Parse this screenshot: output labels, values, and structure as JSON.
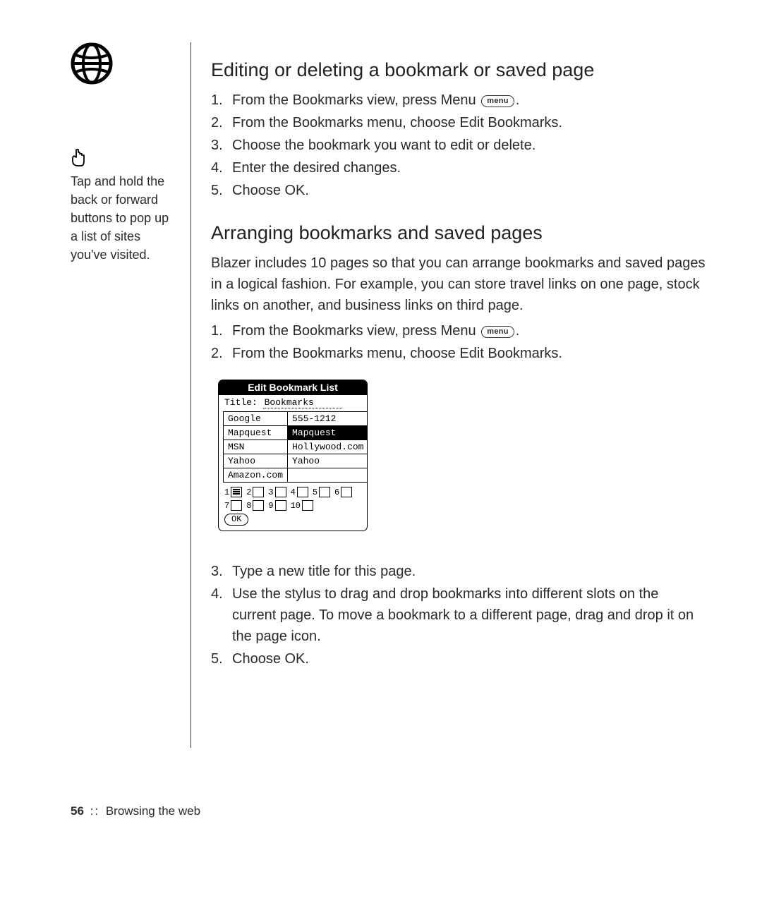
{
  "sidebar": {
    "tip": "Tap and hold the back or forward buttons to pop up a list of sites you've visited."
  },
  "sections": {
    "edit": {
      "heading": "Editing or deleting a bookmark or saved page",
      "steps": [
        [
          "1.",
          "From the Bookmarks view, press Menu",
          "MENU_BADGE",
          "."
        ],
        [
          "2.",
          "From the Bookmarks menu, choose Edit Bookmarks."
        ],
        [
          "3.",
          "Choose the bookmark you want to edit or delete."
        ],
        [
          "4.",
          "Enter the desired changes."
        ],
        [
          "5.",
          "Choose OK."
        ]
      ]
    },
    "arrange": {
      "heading": "Arranging bookmarks and saved pages",
      "intro": "Blazer includes 10 pages so that you can arrange bookmarks and saved pages in a logical fashion. For example, you can store travel links on one page, stock links on another, and business links on third page.",
      "steps_a": [
        [
          "1.",
          "From the Bookmarks view, press Menu",
          "MENU_BADGE",
          "."
        ],
        [
          "2.",
          "From the Bookmarks menu, choose Edit Bookmarks."
        ]
      ],
      "steps_b": [
        [
          "3.",
          "Type a new title for this page."
        ],
        [
          "4.",
          "Use the stylus to drag and drop bookmarks into different slots on the current page. To move a bookmark to a different page, drag and drop it on the page icon."
        ],
        [
          "5.",
          "Choose OK."
        ]
      ]
    }
  },
  "menu_badge_label": "menu",
  "palm_dialog": {
    "title": "Edit Bookmark List",
    "field_label": "Title:",
    "field_value": "Bookmarks",
    "rows": [
      {
        "left": "Google",
        "right": "555-1212"
      },
      {
        "left": "Mapquest",
        "right": "Mapquest",
        "right_selected": true
      },
      {
        "left": "MSN",
        "right": "Hollywood.com"
      },
      {
        "left": "Yahoo",
        "right": "Yahoo"
      },
      {
        "left": "Amazon.com",
        "right": ""
      }
    ],
    "pages": [
      1,
      2,
      3,
      4,
      5,
      6,
      7,
      8,
      9,
      10
    ],
    "ok_label": "OK"
  },
  "footer": {
    "page_number": "56",
    "separator": "::",
    "title": "Browsing the web"
  }
}
